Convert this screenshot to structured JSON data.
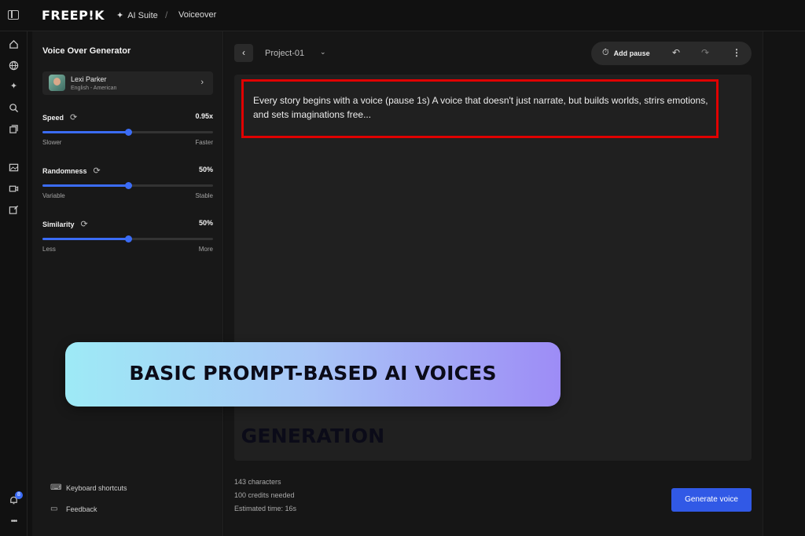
{
  "header": {
    "logo": "FREEP!K",
    "suite_label": "AI Suite",
    "separator": "/",
    "current_page": "Voiceover"
  },
  "rail": {
    "icons": [
      "panel-toggle-icon",
      "home-icon",
      "globe-icon",
      "sparkle-icon",
      "search-icon",
      "library-icon",
      "image-icon",
      "video-icon",
      "edit-icon",
      "bell-icon",
      "more-icon"
    ],
    "notification_count": "8",
    "more_label": "•••"
  },
  "settings": {
    "title": "Voice Over Generator",
    "voice": {
      "name": "Lexi Parker",
      "language": "English - American"
    },
    "sliders": [
      {
        "label": "Speed",
        "value_text": "0.95x",
        "fraction": 0.5,
        "min_label": "Slower",
        "max_label": "Faster"
      },
      {
        "label": "Randomness",
        "value_text": "50%",
        "fraction": 0.5,
        "min_label": "Variable",
        "max_label": "Stable"
      },
      {
        "label": "Similarity",
        "value_text": "50%",
        "fraction": 0.5,
        "min_label": "Less",
        "max_label": "More"
      }
    ],
    "footer": {
      "shortcuts": "Keyboard shortcuts",
      "feedback": "Feedback"
    }
  },
  "main": {
    "project_name": "Project-01",
    "toolbar": {
      "add_pause": "Add pause"
    },
    "editor_text": "Every story begins with a voice (pause 1s) A voice that doesn't just narrate, but builds worlds, strirs emotions, and sets imaginations free...",
    "stats": {
      "characters": "143 characters",
      "credits": "100 credits needed",
      "estimated": "Estimated time: 16s"
    },
    "generate_label": "Generate voice"
  },
  "banner": {
    "text": "BASIC PROMPT-BASED AI VOICES GENERATION"
  },
  "colors": {
    "accent": "#3b6cf6",
    "highlight": "#e00000",
    "button": "#3159e6"
  }
}
